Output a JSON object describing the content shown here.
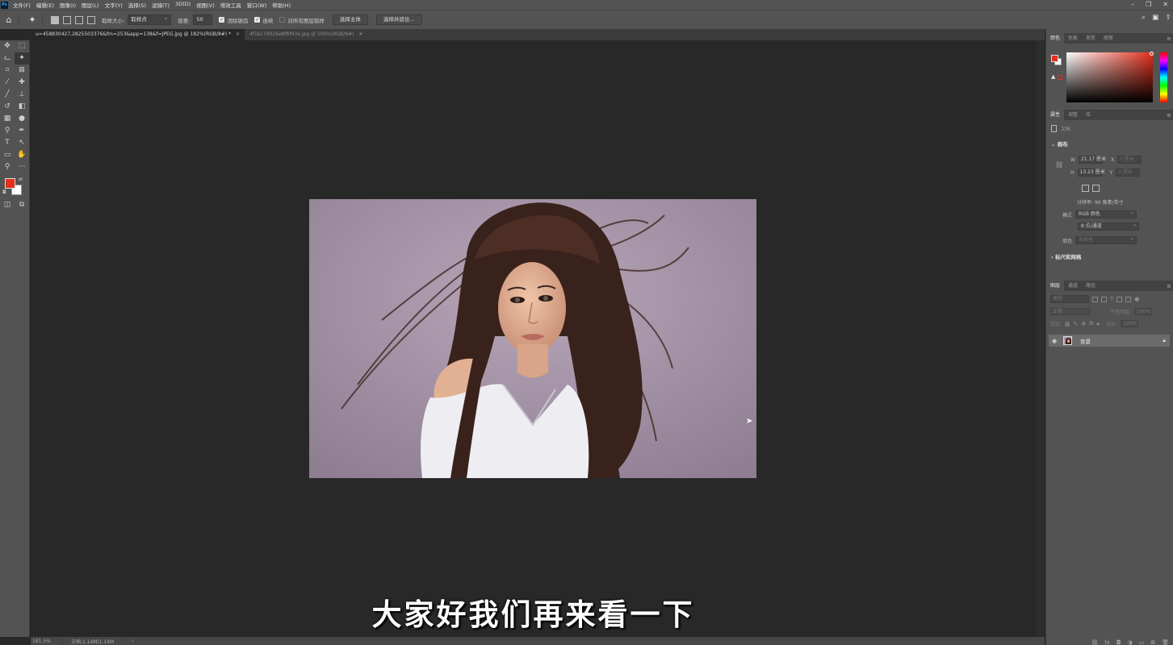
{
  "menu": {
    "items": [
      "文件(F)",
      "编辑(E)",
      "图像(I)",
      "图层(L)",
      "文字(Y)",
      "选择(S)",
      "滤镜(T)",
      "3D(D)",
      "视图(V)",
      "增效工具",
      "窗口(W)",
      "帮助(H)"
    ]
  },
  "options": {
    "sample_size_label": "取样大小:",
    "sample_size_value": "取样点",
    "tolerance_label": "容差:",
    "tolerance_value": "50",
    "antialias_label": "消除锯齿",
    "contiguous_label": "连续",
    "all_layers_label": "对所有图层取样",
    "select_subject_label": "选择主体",
    "select_mask_label": "选择并遮住..."
  },
  "tabs": [
    {
      "label": "u=458830427,2825503376&fm=253&app=138&f=JPEG.jpg @ 182%(RGB/8#) *"
    },
    {
      "label": "4f1bc7d026e8fbf93a.jpg @ 100%(RGB/8#)"
    }
  ],
  "canvas": {
    "subtitle": "大家好我们再来看一下"
  },
  "status": {
    "zoom": "181.5%",
    "doc": "文档:1.14M/1.14M"
  },
  "color_panel": {
    "tabs": [
      "颜色",
      "色板",
      "渐变",
      "图案"
    ],
    "foreground": "#e2301c",
    "background": "#ffffff"
  },
  "properties": {
    "tabs": [
      "属性",
      "调整",
      "库"
    ],
    "doc_label": "文档",
    "canvas_section": "画布",
    "w_label": "W",
    "w_value": "21.17 厘米",
    "x_label": "X",
    "x_value": "0 厘米",
    "h_label": "H",
    "h_value": "13.23 厘米",
    "y_label": "Y",
    "y_value": "0 厘米",
    "resolution": "分辨率: 96 像素/英寸",
    "mode_label": "模式",
    "mode_value": "RGB 颜色",
    "depth_value": "8 位/通道",
    "fill_label": "填色",
    "fill_value": "背景色",
    "rulers_section": "标尺和网格"
  },
  "layers": {
    "tabs": [
      "图层",
      "通道",
      "路径"
    ],
    "kind_placeholder": "类型",
    "blend_mode": "正常",
    "opacity_label": "不透明度:",
    "opacity_value": "100%",
    "lock_label": "锁定:",
    "fill_label": "填充:",
    "fill_value": "100%",
    "layer_name": "背景"
  }
}
